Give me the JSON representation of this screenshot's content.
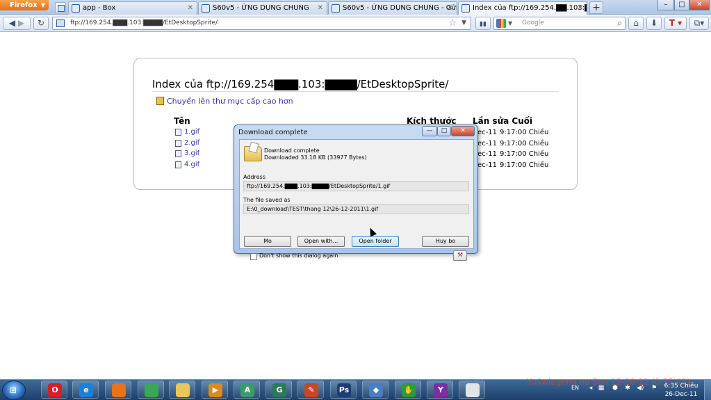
{
  "browser": {
    "app_button": "Firefox",
    "tabs": [
      {
        "label": "app - Box",
        "active": false
      },
      {
        "label": "S60v5 - ỨNG DỤNG CHUNG",
        "active": false
      },
      {
        "label": "S60v5 - ỨNG DỤNG CHUNG - Gửi Ch...",
        "active": false
      },
      {
        "label": "Index của ftp://169.254.▇▇.103:▇▇/...",
        "active": true
      }
    ],
    "new_tab": "+",
    "window_controls": {
      "minimize": "–",
      "maximize": "□",
      "close": "✕"
    },
    "url": "ftp://169.254.▇▇▇.103:▇▇▇▇/EtDesktopSprite/",
    "search_placeholder": "Google",
    "nav_icons": [
      "back-arrow-icon",
      "forward-arrow-icon",
      "reload-icon",
      "home-icon",
      "download-icon",
      "translate-icon",
      "addon-icon"
    ]
  },
  "page": {
    "title": "Index của ftp://169.254▇▇▇.103:▇▇▇▇/EtDesktopSprite/",
    "up_link": "Chuyển lên thư mục cấp cao hơn",
    "columns": {
      "name": "Tên",
      "size": "Kích thước",
      "modified": "Lần sửa Cuối"
    },
    "rows": [
      {
        "name": "1.gif",
        "date": "ec-11",
        "time": "9:17:00 Chiều"
      },
      {
        "name": "2.gif",
        "date": "ec-11",
        "time": "9:17:00 Chiều"
      },
      {
        "name": "3.gif",
        "date": "ec-11",
        "time": "9:17:00 Chiều"
      },
      {
        "name": "4.gif",
        "date": "ec-11",
        "time": "9:17:00 Chiều"
      }
    ]
  },
  "dialog": {
    "title": "Download complete",
    "heading": "Download complete",
    "downloaded": "Downloaded 33.18  KB (33977 Bytes)",
    "address_label": "Address",
    "address": "ftp://169.254.▇▇▇.103:▇▇▇▇/EtDesktopSprite/1.gif",
    "saved_label": "The file saved as",
    "saved_path": "E:\\0_download\\TEST\\thang 12\\26-12-2011\\1.gif",
    "buttons": {
      "open": "Mo",
      "open_with": "Open with...",
      "open_folder": "Open folder",
      "cancel": "Huy bo"
    },
    "checkbox_label": "Don't show this dialog again",
    "controls": {
      "minimize": "—",
      "maximize": "□",
      "close": "✕"
    }
  },
  "taskbar": {
    "apps": [
      {
        "name": "opera",
        "glyph": "O",
        "color": "#d4202a"
      },
      {
        "name": "ie",
        "glyph": "e",
        "color": "#1e7fd6"
      },
      {
        "name": "firefox",
        "glyph": "",
        "color": "#e8731a"
      },
      {
        "name": "chrome",
        "glyph": "",
        "color": "#3aa757"
      },
      {
        "name": "explorer",
        "glyph": "",
        "color": "#e8c85a"
      },
      {
        "name": "media",
        "glyph": "▶",
        "color": "#d88b1e"
      },
      {
        "name": "app-a",
        "glyph": "A",
        "color": "#3b9c6a"
      },
      {
        "name": "app-g",
        "glyph": "G",
        "color": "#2d7a56"
      },
      {
        "name": "pen",
        "glyph": "✎",
        "color": "#c8452c"
      },
      {
        "name": "photoshop",
        "glyph": "Ps",
        "color": "#1b3e74"
      },
      {
        "name": "network",
        "glyph": "◆",
        "color": "#4a7fbf"
      },
      {
        "name": "hand",
        "glyph": "✋",
        "color": "#2e9a3c"
      },
      {
        "name": "yahoo",
        "glyph": "Y",
        "color": "#7b2fa3"
      },
      {
        "name": "app-last",
        "glyph": "",
        "color": "#e4e4e4"
      }
    ],
    "language": "EN",
    "time": "6:35 Chiều",
    "date": "26-Dec-11"
  },
  "watermark": "Yu4wiegena.no Sun 12-26-11 (0:35:43)"
}
